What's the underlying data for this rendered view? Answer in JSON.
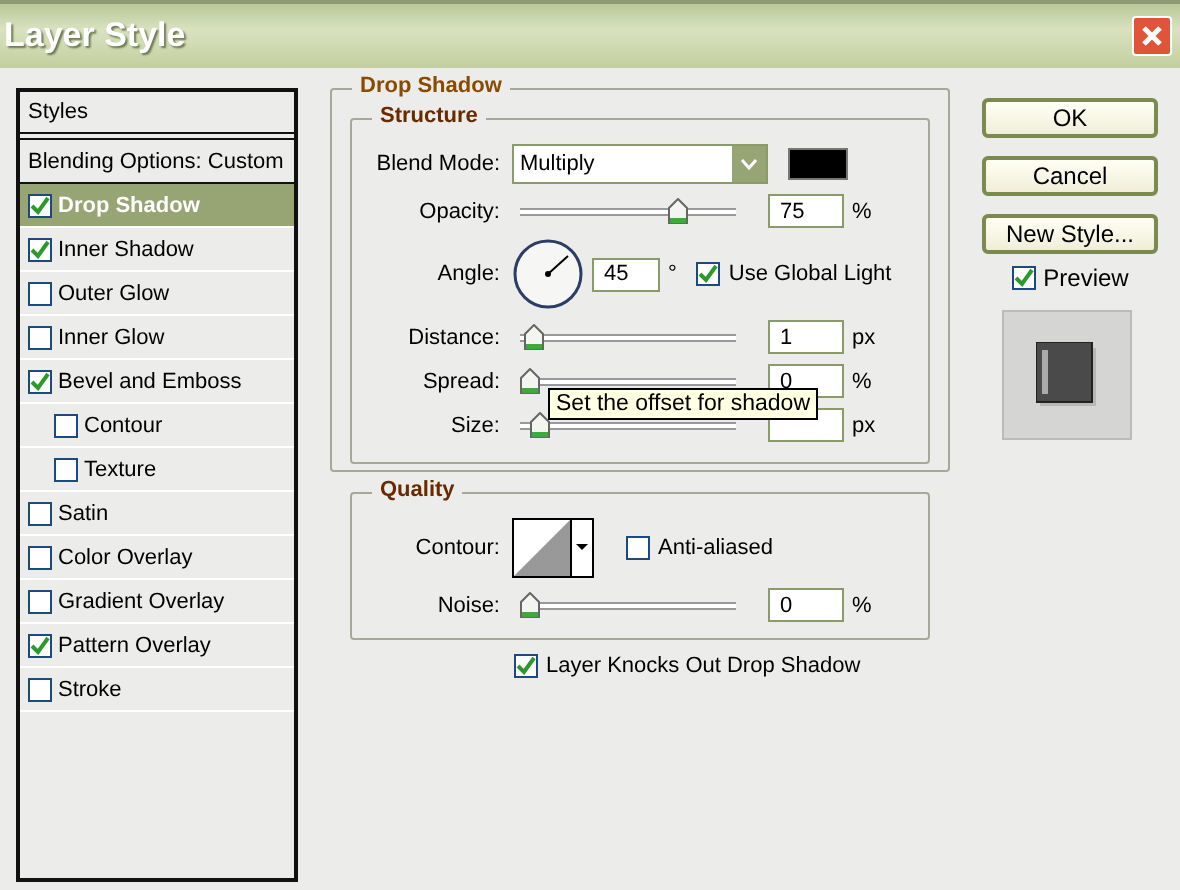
{
  "window": {
    "title": "Layer Style"
  },
  "styles_list": {
    "header": "Styles",
    "items": [
      {
        "label": "Blending Options: Custom",
        "kind": "plain",
        "selected": false
      },
      {
        "label": "Drop Shadow",
        "kind": "check",
        "checked": true,
        "selected": true
      },
      {
        "label": "Inner Shadow",
        "kind": "check",
        "checked": true,
        "selected": false
      },
      {
        "label": "Outer Glow",
        "kind": "check",
        "checked": false,
        "selected": false
      },
      {
        "label": "Inner Glow",
        "kind": "check",
        "checked": false,
        "selected": false
      },
      {
        "label": "Bevel and Emboss",
        "kind": "check",
        "checked": true,
        "selected": false,
        "children": [
          {
            "label": "Contour",
            "kind": "check",
            "checked": false,
            "selected": false
          },
          {
            "label": "Texture",
            "kind": "check",
            "checked": false,
            "selected": false
          }
        ]
      },
      {
        "label": "Satin",
        "kind": "check",
        "checked": false,
        "selected": false
      },
      {
        "label": "Color Overlay",
        "kind": "check",
        "checked": false,
        "selected": false
      },
      {
        "label": "Gradient Overlay",
        "kind": "check",
        "checked": false,
        "selected": false
      },
      {
        "label": "Pattern Overlay",
        "kind": "check",
        "checked": true,
        "selected": false
      },
      {
        "label": "Stroke",
        "kind": "check",
        "checked": false,
        "selected": false
      }
    ]
  },
  "drop_shadow": {
    "title": "Drop Shadow",
    "structure": {
      "title": "Structure",
      "rows": [
        {
          "kind": "select",
          "label": "Blend Mode:",
          "value": "Multiply"
        },
        {
          "kind": "slider",
          "label": "Opacity:",
          "level": 0.75,
          "value": "75",
          "unit": "%"
        },
        {
          "kind": "angle",
          "label": "Angle:",
          "value": "45",
          "unit": "°",
          "global_light": {
            "label": "Use Global Light",
            "checked": true
          }
        },
        {
          "kind": "slider",
          "label": "Distance:",
          "level": 0.02,
          "value": "1",
          "unit": "px"
        },
        {
          "kind": "slider",
          "label": "Spread:",
          "level": 0,
          "value": "0",
          "unit": "%"
        },
        {
          "kind": "slider",
          "label": "Size:",
          "level": 0.05,
          "unit": "px"
        }
      ]
    },
    "tooltip": "Set the offset for shadow",
    "quality": {
      "title": "Quality",
      "contour": {
        "label": "Contour:"
      },
      "anti_aliased": {
        "label": "Anti-aliased",
        "checked": false
      },
      "noise": {
        "label": "Noise:",
        "level": 0,
        "value": "0",
        "unit": "%"
      }
    },
    "knockout": {
      "label": "Layer Knocks Out Drop Shadow",
      "checked": true
    }
  },
  "buttons": [
    "OK",
    "Cancel",
    "New Style..."
  ],
  "preview": {
    "label": "Preview",
    "checked": true
  }
}
